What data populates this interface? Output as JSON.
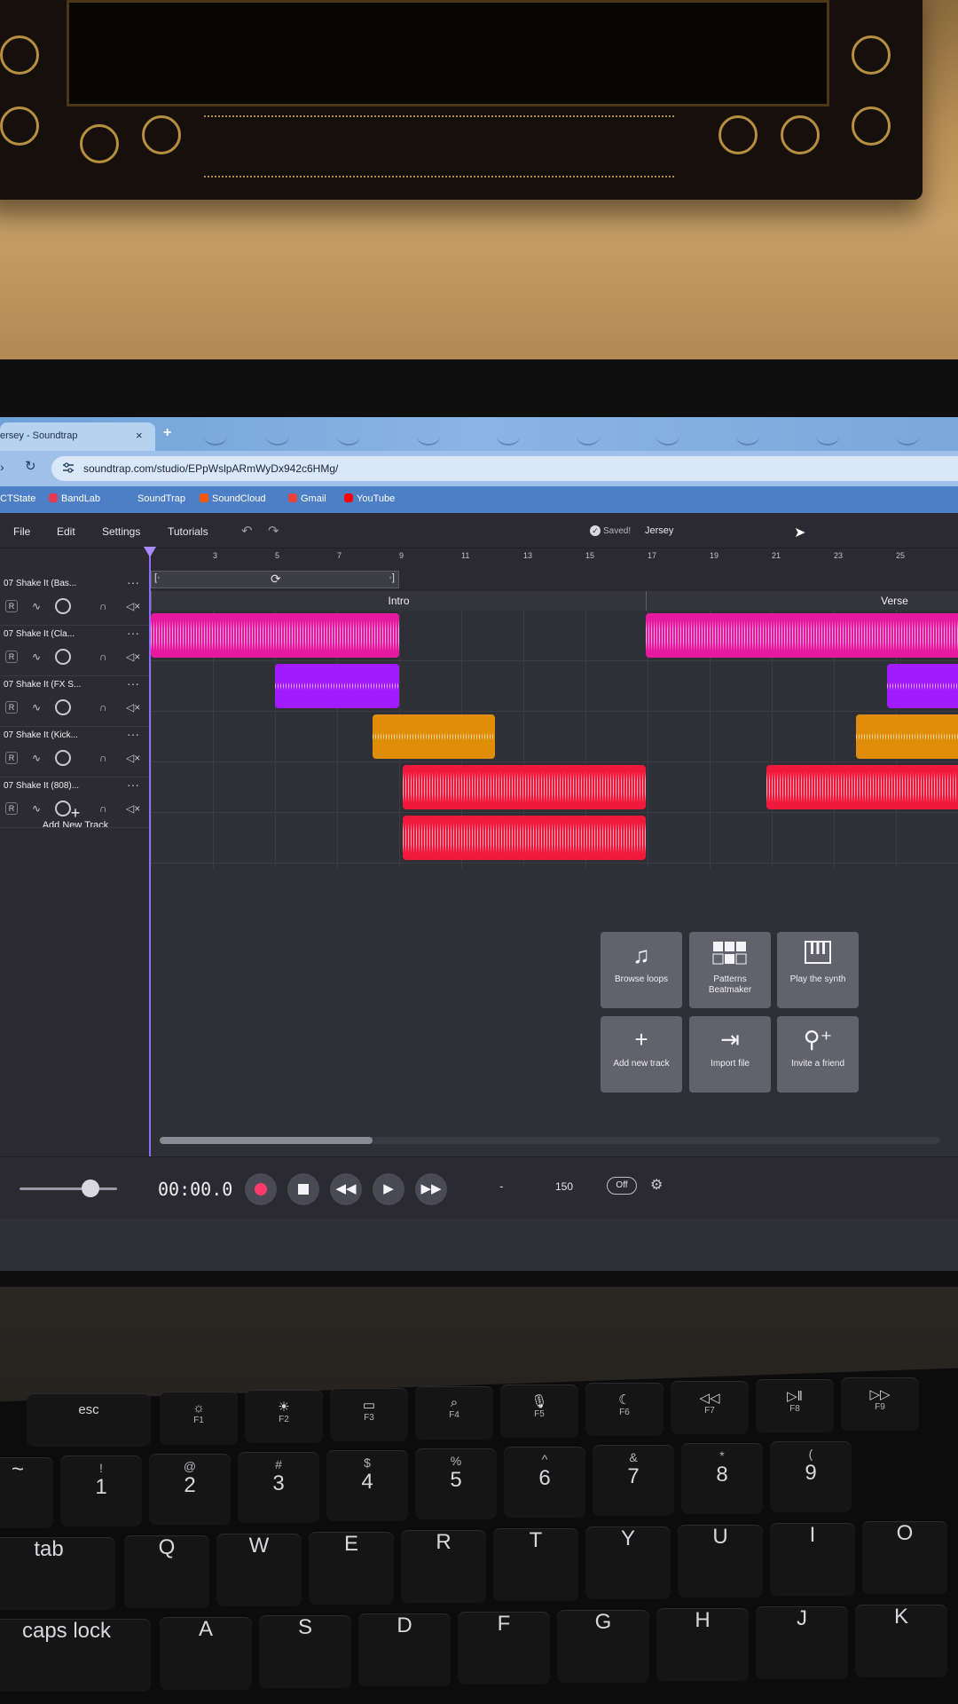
{
  "browser": {
    "tab_title": "ersey - Soundtrap",
    "tab_close": "×",
    "new_tab": "+",
    "url": "soundtrap.com/studio/EPpWslpARmWyDx942c6HMg/",
    "bookmarks": [
      {
        "label": "CTState",
        "color": ""
      },
      {
        "label": "BandLab",
        "color": "#e8384f"
      },
      {
        "label": "SoundTrap",
        "color": ""
      },
      {
        "label": "SoundCloud",
        "color": "#ff5500"
      },
      {
        "label": "Gmail",
        "color": "#ea4335"
      },
      {
        "label": "YouTube",
        "color": "#ff0000"
      }
    ]
  },
  "menubar": {
    "items": [
      "File",
      "Edit",
      "Settings",
      "Tutorials"
    ],
    "saved_label": "Saved!",
    "project_name": "Jersey"
  },
  "ruler": {
    "ticks": [
      "3",
      "5",
      "7",
      "9",
      "11",
      "13",
      "15",
      "17",
      "19",
      "21",
      "23",
      "25"
    ]
  },
  "sections": [
    "Intro",
    "Verse"
  ],
  "tracks": [
    {
      "name": "07 Shake It (Bas...",
      "color": "#e6189e"
    },
    {
      "name": "07 Shake It (Cla...",
      "color": "#a21bff"
    },
    {
      "name": "07 Shake It (FX S...",
      "color": "#e08e07"
    },
    {
      "name": "07 Shake It (Kick...",
      "color": "#f0193b"
    },
    {
      "name": "07 Shake It (808)...",
      "color": "#f0193b"
    }
  ],
  "add_track_label": "Add New Track",
  "quick_actions": [
    {
      "label": "Browse loops",
      "icon": "music-note-icon"
    },
    {
      "label": "Patterns Beatmaker",
      "icon": "grid-icon"
    },
    {
      "label": "Play the synth",
      "icon": "piano-icon"
    },
    {
      "label": "Add new track",
      "icon": "plus-icon"
    },
    {
      "label": "Import file",
      "icon": "import-icon"
    },
    {
      "label": "Invite a friend",
      "icon": "add-user-icon"
    }
  ],
  "transport": {
    "time": "00:00.0",
    "key": "-",
    "bpm": "150",
    "metronome": "Off"
  },
  "keyboard": {
    "function_row": [
      {
        "key": "esc",
        "sub": ""
      },
      {
        "key": "☼",
        "sub": "F1"
      },
      {
        "key": "☀",
        "sub": "F2"
      },
      {
        "key": "▭",
        "sub": "F3"
      },
      {
        "key": "⌕",
        "sub": "F4"
      },
      {
        "key": "🎙",
        "sub": "F5"
      },
      {
        "key": "☾",
        "sub": "F6"
      },
      {
        "key": "◁◁",
        "sub": "F7"
      },
      {
        "key": "▷‖",
        "sub": "F8"
      },
      {
        "key": "▷▷",
        "sub": "F9"
      }
    ],
    "number_row": [
      {
        "key": "1",
        "sub": "!"
      },
      {
        "key": "2",
        "sub": "@"
      },
      {
        "key": "3",
        "sub": "#"
      },
      {
        "key": "4",
        "sub": "$"
      },
      {
        "key": "5",
        "sub": "%"
      },
      {
        "key": "6",
        "sub": "^"
      },
      {
        "key": "7",
        "sub": "&"
      },
      {
        "key": "8",
        "sub": "*"
      },
      {
        "key": "9",
        "sub": "("
      }
    ],
    "qwerty_row": [
      "Q",
      "W",
      "E",
      "R",
      "T",
      "Y",
      "U",
      "I",
      "O"
    ],
    "home_row": [
      "A",
      "S",
      "D",
      "F",
      "G",
      "H",
      "J",
      "K"
    ],
    "tab_label": "tab",
    "caps_label": "caps lock",
    "tilde": "~"
  }
}
